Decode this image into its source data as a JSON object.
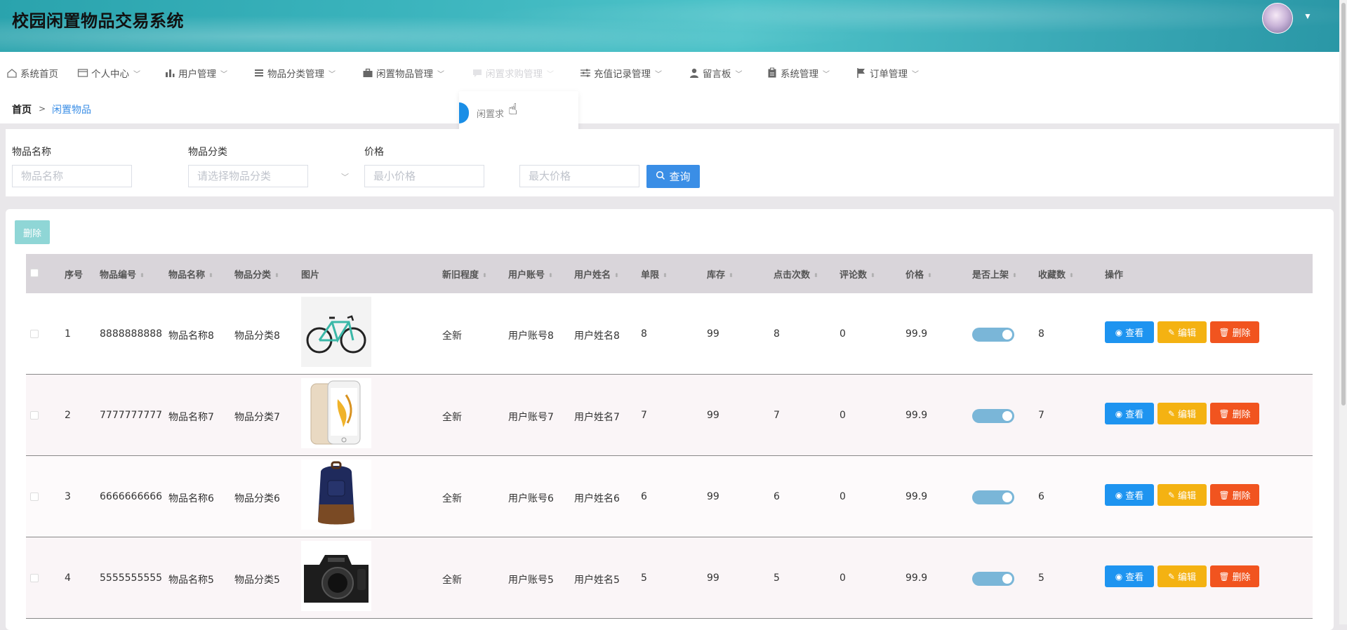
{
  "app": {
    "title": "校园闲置物品交易系统"
  },
  "header": {
    "avatar_alt": "avatar"
  },
  "nav": {
    "items": [
      {
        "label": "系统首页",
        "icon": "home-icon",
        "has_caret": false
      },
      {
        "label": "个人中心",
        "icon": "card-icon",
        "has_caret": true
      },
      {
        "label": "用户管理",
        "icon": "bar-chart-icon",
        "has_caret": true
      },
      {
        "label": "物品分类管理",
        "icon": "list-icon",
        "has_caret": true
      },
      {
        "label": "闲置物品管理",
        "icon": "briefcase-icon",
        "has_caret": true
      },
      {
        "label": "闲置求购管理",
        "icon": "chat-icon",
        "has_caret": true
      },
      {
        "label": "充值记录管理",
        "icon": "sliders-icon",
        "has_caret": true
      },
      {
        "label": "留言板",
        "icon": "user-icon",
        "has_caret": true
      },
      {
        "label": "系统管理",
        "icon": "clipboard-icon",
        "has_caret": true
      },
      {
        "label": "订单管理",
        "icon": "flag-icon",
        "has_caret": true
      }
    ],
    "dropdown_item": "闲置求"
  },
  "breadcrumb": {
    "home": "首页",
    "separator": ">",
    "current": "闲置物品"
  },
  "search": {
    "name_label": "物品名称",
    "name_placeholder": "物品名称",
    "category_label": "物品分类",
    "category_placeholder": "请选择物品分类",
    "price_label": "价格",
    "min_price_placeholder": "最小价格",
    "max_price_placeholder": "最大价格",
    "query_button": "查询"
  },
  "toolbar": {
    "delete_label": "删除"
  },
  "table": {
    "columns": [
      "序号",
      "物品编号",
      "物品名称",
      "物品分类",
      "图片",
      "新旧程度",
      "用户账号",
      "用户姓名",
      "单限",
      "库存",
      "点击次数",
      "评论数",
      "价格",
      "是否上架",
      "收藏数",
      "操作"
    ],
    "rows": [
      {
        "index": "1",
        "code": "8888888888",
        "name": "物品名称8",
        "category": "物品分类8",
        "image": "bicycle",
        "condition": "全新",
        "account": "用户账号8",
        "username": "用户姓名8",
        "limit": "8",
        "stock": "99",
        "clicks": "8",
        "comments": "0",
        "price": "99.9",
        "listed": true,
        "favorites": "8"
      },
      {
        "index": "2",
        "code": "7777777777",
        "name": "物品名称7",
        "category": "物品分类7",
        "image": "phone",
        "condition": "全新",
        "account": "用户账号7",
        "username": "用户姓名7",
        "limit": "7",
        "stock": "99",
        "clicks": "7",
        "comments": "0",
        "price": "99.9",
        "listed": true,
        "favorites": "7"
      },
      {
        "index": "3",
        "code": "6666666666",
        "name": "物品名称6",
        "category": "物品分类6",
        "image": "backpack",
        "condition": "全新",
        "account": "用户账号6",
        "username": "用户姓名6",
        "limit": "6",
        "stock": "99",
        "clicks": "6",
        "comments": "0",
        "price": "99.9",
        "listed": true,
        "favorites": "6"
      },
      {
        "index": "4",
        "code": "5555555555",
        "name": "物品名称5",
        "category": "物品分类5",
        "image": "camera",
        "condition": "全新",
        "account": "用户账号5",
        "username": "用户姓名5",
        "limit": "5",
        "stock": "99",
        "clicks": "5",
        "comments": "0",
        "price": "99.9",
        "listed": true,
        "favorites": "5"
      }
    ],
    "actions": {
      "view": "查看",
      "edit": "编辑",
      "delete": "删除"
    }
  },
  "colors": {
    "primary": "#3a8ee6",
    "view": "#1e94f0",
    "edit": "#f4b212",
    "delete": "#f1541f",
    "batch_delete": "#8fd6d6",
    "toggle_on": "#7ab6d8"
  }
}
